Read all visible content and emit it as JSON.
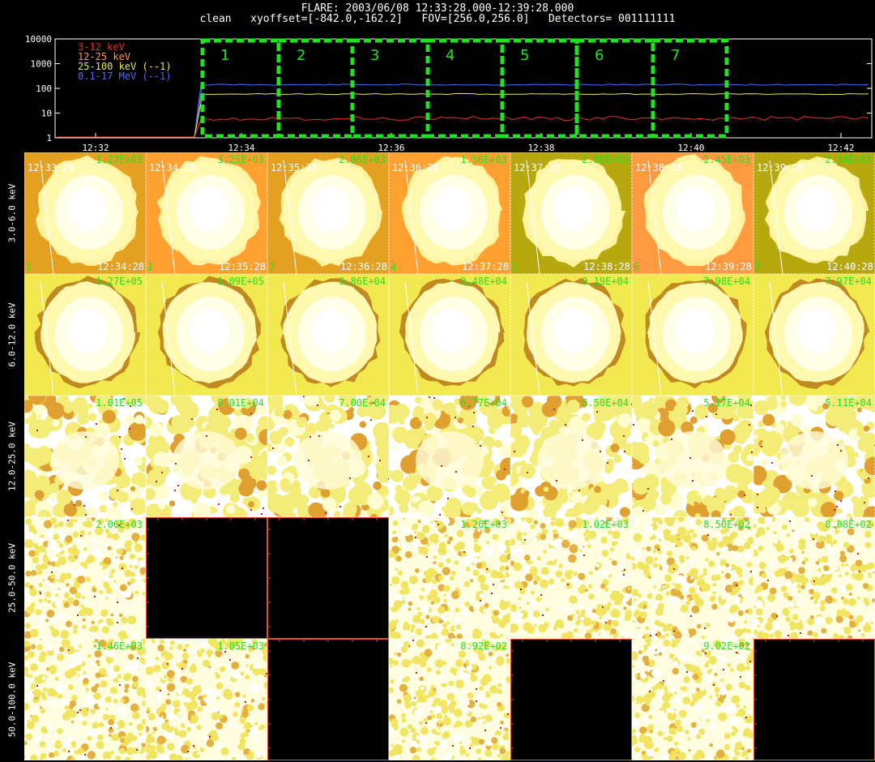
{
  "header": {
    "title": "FLARE: 2003/06/08 12:33:28.000-12:39:28.000",
    "subtitle": "clean   xyoffset=[-842.0,-162.2]   FOV=[256.0,256.0]   Detectors= 001111111"
  },
  "lightcurve": {
    "y_ticks": [
      "10000",
      "1000",
      "100",
      "10",
      "1"
    ],
    "x_ticks": [
      "12:32",
      "12:34",
      "12:36",
      "12:38",
      "12:40",
      "12:42"
    ],
    "legend": [
      {
        "label": "3-12 keV",
        "color": "#e0332a"
      },
      {
        "label": "12-25 keV",
        "color": "#ff9a3c"
      },
      {
        "label": "25-100 keV (--1)",
        "color": "#e8e84a"
      },
      {
        "label": "0.1-17 MeV (--1)",
        "color": "#4a6cff"
      }
    ],
    "interval_labels": [
      "1",
      "2",
      "3",
      "4",
      "5",
      "6",
      "7"
    ],
    "interval_color": "#22e022"
  },
  "energy_bands": [
    "3.0-6.0 keV",
    "6.0-12.0 keV",
    "12.0-25.0 keV",
    "25.0-50.0 keV",
    "50.0-100.0 keV"
  ],
  "times": [
    "12:33:28",
    "12:34:28",
    "12:35:28",
    "12:36:28",
    "12:37:28",
    "12:38:28",
    "12:39:28"
  ],
  "rows": [
    {
      "kind": "blob",
      "bg": [
        "#e4a020",
        "#ffa030",
        "#e4a020",
        "#ffa030",
        "#b8a810",
        "#ff9a40",
        "#b8a810"
      ],
      "max": [
        "1.27E+03",
        "3.25E+03",
        "2.86E+03",
        "1.56E+03",
        "2.98E+03",
        "2.45E+03",
        "2.34E+03"
      ],
      "index": [
        "1",
        "2",
        "3",
        "4",
        "5",
        "6",
        "7"
      ],
      "start": [
        "12:33:28",
        "12:34:28",
        "12:35:28",
        "12:36:28",
        "12:37:28",
        "12:38:28",
        "12:39:28"
      ],
      "end": [
        "12:34:28",
        "12:35:28",
        "12:36:28",
        "12:37:28",
        "12:38:28",
        "12:39:28",
        "12:40:28"
      ]
    },
    {
      "kind": "blob2",
      "bg": [
        "#f2e850",
        "#f2e850",
        "#f2e850",
        "#f2e850",
        "#f2e850",
        "#f2e850",
        "#f2e850"
      ],
      "max": [
        "1.27E+05",
        "1.09E+05",
        "9.86E+04",
        "9.48E+04",
        "9.19E+04",
        "7.98E+04",
        "7.97E+04"
      ]
    },
    {
      "kind": "speckle",
      "max": [
        "1.01E+05",
        "8.01E+04",
        "7.00E+04",
        "6.77E+04",
        "6.50E+04",
        "5.17E+04",
        "5.11E+04"
      ]
    },
    {
      "kind": "noise",
      "empty": [
        false,
        true,
        true,
        false,
        false,
        false,
        false
      ],
      "max": [
        "2.06E+03",
        "",
        "",
        "1.26E+03",
        "1.02E+03",
        "8.50E+02",
        "8.08E+02"
      ]
    },
    {
      "kind": "noise",
      "empty": [
        false,
        false,
        true,
        false,
        true,
        false,
        true
      ],
      "max": [
        "1.46E+03",
        "1.05E+03",
        "",
        "8.92E+02",
        "",
        "9.02E+02",
        ""
      ]
    }
  ]
}
